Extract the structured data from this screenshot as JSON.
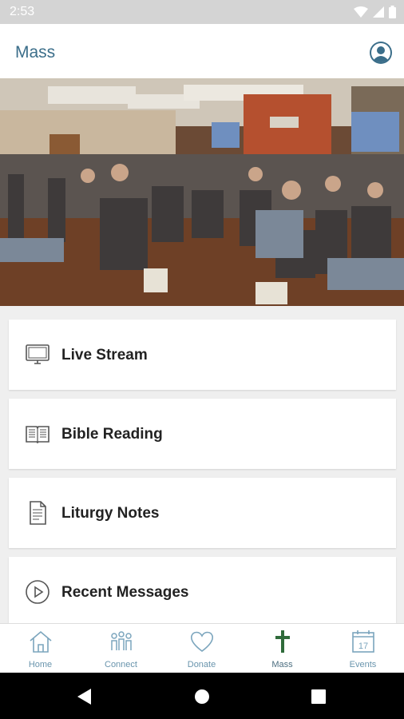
{
  "status_bar": {
    "time": "2:53"
  },
  "app_bar": {
    "title": "Mass"
  },
  "hero": {
    "image": "photo of a congregation seated in a hall facing a speaker and screens"
  },
  "menu": [
    {
      "label": "Live Stream",
      "icon": "monitor-icon"
    },
    {
      "label": "Bible Reading",
      "icon": "book-icon"
    },
    {
      "label": "Liturgy Notes",
      "icon": "document-icon"
    },
    {
      "label": "Recent Messages",
      "icon": "play-circle-icon"
    }
  ],
  "bottom_nav": [
    {
      "label": "Home",
      "icon": "home-icon"
    },
    {
      "label": "Connect",
      "icon": "people-icon"
    },
    {
      "label": "Donate",
      "icon": "heart-icon"
    },
    {
      "label": "Mass",
      "icon": "cross-icon",
      "active": true
    },
    {
      "label": "Events",
      "icon": "calendar-icon",
      "day": "17"
    }
  ],
  "colors": {
    "accent": "#3b6e8a",
    "nav_label": "#6a95ad",
    "cross": "#2f6b3a"
  }
}
